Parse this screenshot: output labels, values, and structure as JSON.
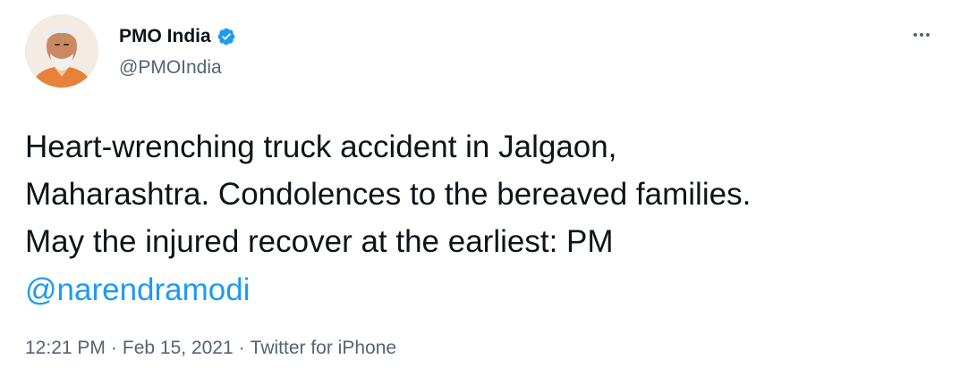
{
  "author": {
    "display_name": "PMO India",
    "handle": "@PMOIndia",
    "verified": true
  },
  "tweet": {
    "text": "Heart-wrenching truck accident in Jalgaon,\nMaharashtra. Condolences to the bereaved families.\nMay the injured recover at the earliest: PM",
    "mention": "@narendramodi"
  },
  "meta": {
    "time": "12:21 PM",
    "date": "Feb 15, 2021",
    "source": "Twitter for iPhone",
    "separator": "·"
  },
  "icons": {
    "verified": "verified-badge-icon",
    "more": "more-options-icon"
  },
  "colors": {
    "link": "#1d9bf0",
    "secondary": "#536471",
    "verified": "#1d9bf0"
  }
}
